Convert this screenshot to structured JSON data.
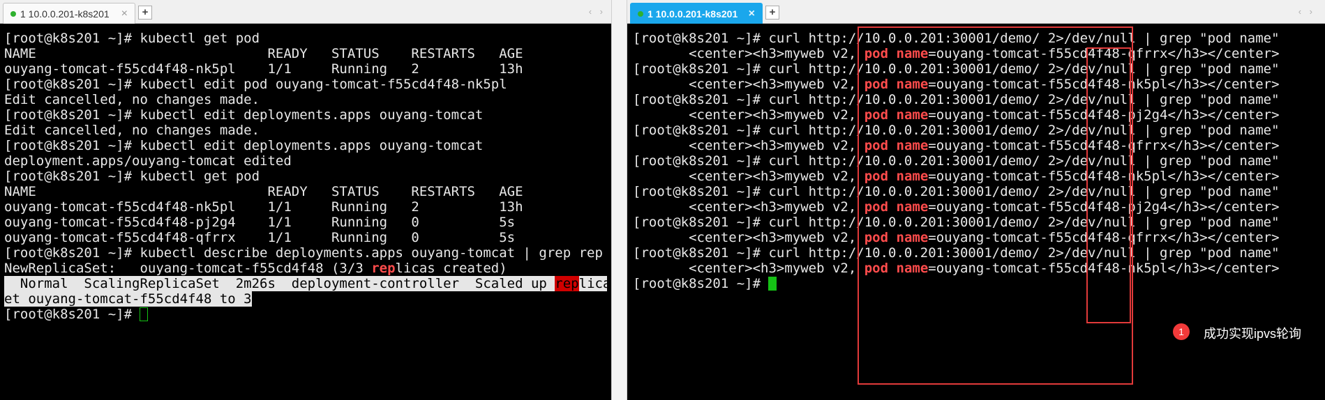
{
  "left": {
    "tab": {
      "label": "1 10.0.0.201-k8s201",
      "close": "×",
      "add": "+",
      "nav": "‹ ›"
    },
    "lines": [
      "[root@k8s201 ~]# kubectl get pod",
      "NAME                             READY   STATUS    RESTARTS   AGE",
      "ouyang-tomcat-f55cd4f48-nk5pl    1/1     Running   2          13h",
      "[root@k8s201 ~]# kubectl edit pod ouyang-tomcat-f55cd4f48-nk5pl",
      "Edit cancelled, no changes made.",
      "[root@k8s201 ~]# kubectl edit deployments.apps ouyang-tomcat",
      "Edit cancelled, no changes made.",
      "[root@k8s201 ~]# kubectl edit deployments.apps ouyang-tomcat",
      "deployment.apps/ouyang-tomcat edited",
      "[root@k8s201 ~]# kubectl get pod",
      "NAME                             READY   STATUS    RESTARTS   AGE",
      "ouyang-tomcat-f55cd4f48-nk5pl    1/1     Running   2          13h",
      "ouyang-tomcat-f55cd4f48-pj2g4    1/1     Running   0          5s",
      "ouyang-tomcat-f55cd4f48-qfrrx    1/1     Running   0          5s",
      "[root@k8s201 ~]# kubectl describe deployments.apps ouyang-tomcat | grep rep"
    ],
    "replicaset_prefix": "NewReplicaSet:   ouyang-tomcat-f55cd4f48 (3/3 ",
    "replicaset_match": "rep",
    "replicaset_suffix": "licas created)",
    "event_line1_prefix": "  Normal  ScalingReplicaSet  2m26s  deployment-controller  Scaled up ",
    "event_line1_match": "rep",
    "event_line1_suffix": "lica s",
    "event_line2": "et ouyang-tomcat-f55cd4f48 to 3",
    "final_prompt": "[root@k8s201 ~]# "
  },
  "right": {
    "tab": {
      "label": "1 10.0.0.201-k8s201",
      "close": "×",
      "add": "+",
      "nav": "‹ ›"
    },
    "command": "[root@k8s201 ~]# curl http://10.0.0.201:30001/demo/ 2>/dev/null | grep \"pod name\"",
    "out_prefix": "       <center><h3>myweb v2, ",
    "match_pod": "pod",
    "match_name": "name",
    "out_mid": "=ouyang-tomcat-f55cd4f48-",
    "out_suffix": "</h3></center>",
    "pods": [
      "qfrrx",
      "nk5pl",
      "pj2g4",
      "qfrrx",
      "nk5pl",
      "pj2g4",
      "qfrrx",
      "nk5pl"
    ],
    "final_prompt": "[root@k8s201 ~]# ",
    "annotation": {
      "badge": "1",
      "text": "成功实现ipvs轮询"
    }
  }
}
